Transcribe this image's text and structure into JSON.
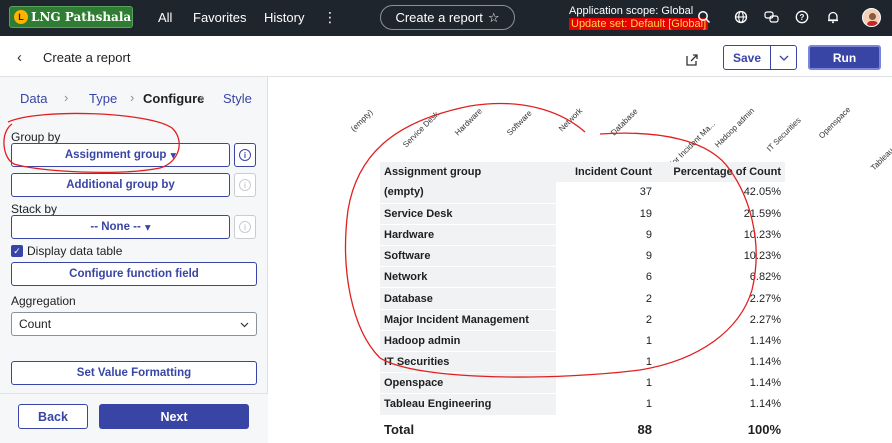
{
  "topnav": {
    "logo_text": "LNG Pathshala",
    "logo_mark": "L",
    "links": [
      "All",
      "Favorites",
      "History"
    ],
    "more_icon": "⋮",
    "create_report": "Create a report",
    "scope_line": "Application scope: Global",
    "update_set": "Update set: Default [Global]"
  },
  "header": {
    "title": "Create a report",
    "save_label": "Save",
    "run_label": "Run"
  },
  "steps": [
    "Data",
    "Type",
    "Configure",
    "Style"
  ],
  "config": {
    "group_by_label": "Group by",
    "group_by_value": "Assignment group",
    "additional_group_by": "Additional group by",
    "stack_by_label": "Stack by",
    "stack_by_value": "-- None --",
    "display_table_label": "Display data table",
    "configure_function": "Configure function field",
    "aggregation_label": "Aggregation",
    "aggregation_value": "Count",
    "set_value_formatting": "Set Value Formatting",
    "back_label": "Back",
    "next_label": "Next"
  },
  "table": {
    "headers": [
      "Assignment group",
      "Incident Count",
      "Percentage of Count"
    ],
    "rows": [
      [
        "(empty)",
        "37",
        "42.05%"
      ],
      [
        "Service Desk",
        "19",
        "21.59%"
      ],
      [
        "Hardware",
        "9",
        "10.23%"
      ],
      [
        "Software",
        "9",
        "10.23%"
      ],
      [
        "Network",
        "6",
        "6.82%"
      ],
      [
        "Database",
        "2",
        "2.27%"
      ],
      [
        "Major Incident Management",
        "2",
        "2.27%"
      ],
      [
        "Hadoop admin",
        "1",
        "1.14%"
      ],
      [
        "IT Securities",
        "1",
        "1.14%"
      ],
      [
        "Openspace",
        "1",
        "1.14%"
      ],
      [
        "Tableau Engineering",
        "1",
        "1.14%"
      ]
    ],
    "total": [
      "Total",
      "88",
      "100%"
    ]
  },
  "chart_axis_labels": [
    "(empty)",
    "Service Desk",
    "Hardware",
    "Software",
    "Network",
    "Database",
    "Major Incident Ma...",
    "Hadoop admin",
    "IT Securities",
    "Openspace",
    "Tableau Engineering"
  ],
  "colors": {
    "accent": "#3945a5",
    "nav_bg": "#1f252d",
    "update_set_bg": "#e60000",
    "update_set_fg": "#ffd84d",
    "annotation": "#e02020"
  }
}
